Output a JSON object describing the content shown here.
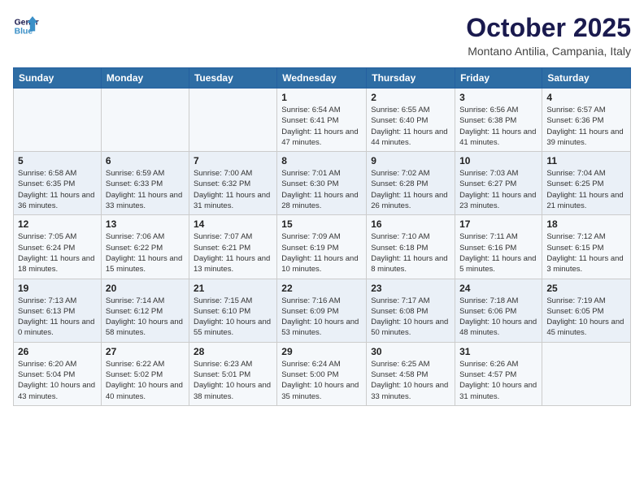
{
  "logo": {
    "line1": "General",
    "line2": "Blue"
  },
  "title": "October 2025",
  "subtitle": "Montano Antilia, Campania, Italy",
  "days_of_week": [
    "Sunday",
    "Monday",
    "Tuesday",
    "Wednesday",
    "Thursday",
    "Friday",
    "Saturday"
  ],
  "weeks": [
    [
      {
        "day": "",
        "info": ""
      },
      {
        "day": "",
        "info": ""
      },
      {
        "day": "",
        "info": ""
      },
      {
        "day": "1",
        "info": "Sunrise: 6:54 AM\nSunset: 6:41 PM\nDaylight: 11 hours and 47 minutes."
      },
      {
        "day": "2",
        "info": "Sunrise: 6:55 AM\nSunset: 6:40 PM\nDaylight: 11 hours and 44 minutes."
      },
      {
        "day": "3",
        "info": "Sunrise: 6:56 AM\nSunset: 6:38 PM\nDaylight: 11 hours and 41 minutes."
      },
      {
        "day": "4",
        "info": "Sunrise: 6:57 AM\nSunset: 6:36 PM\nDaylight: 11 hours and 39 minutes."
      }
    ],
    [
      {
        "day": "5",
        "info": "Sunrise: 6:58 AM\nSunset: 6:35 PM\nDaylight: 11 hours and 36 minutes."
      },
      {
        "day": "6",
        "info": "Sunrise: 6:59 AM\nSunset: 6:33 PM\nDaylight: 11 hours and 33 minutes."
      },
      {
        "day": "7",
        "info": "Sunrise: 7:00 AM\nSunset: 6:32 PM\nDaylight: 11 hours and 31 minutes."
      },
      {
        "day": "8",
        "info": "Sunrise: 7:01 AM\nSunset: 6:30 PM\nDaylight: 11 hours and 28 minutes."
      },
      {
        "day": "9",
        "info": "Sunrise: 7:02 AM\nSunset: 6:28 PM\nDaylight: 11 hours and 26 minutes."
      },
      {
        "day": "10",
        "info": "Sunrise: 7:03 AM\nSunset: 6:27 PM\nDaylight: 11 hours and 23 minutes."
      },
      {
        "day": "11",
        "info": "Sunrise: 7:04 AM\nSunset: 6:25 PM\nDaylight: 11 hours and 21 minutes."
      }
    ],
    [
      {
        "day": "12",
        "info": "Sunrise: 7:05 AM\nSunset: 6:24 PM\nDaylight: 11 hours and 18 minutes."
      },
      {
        "day": "13",
        "info": "Sunrise: 7:06 AM\nSunset: 6:22 PM\nDaylight: 11 hours and 15 minutes."
      },
      {
        "day": "14",
        "info": "Sunrise: 7:07 AM\nSunset: 6:21 PM\nDaylight: 11 hours and 13 minutes."
      },
      {
        "day": "15",
        "info": "Sunrise: 7:09 AM\nSunset: 6:19 PM\nDaylight: 11 hours and 10 minutes."
      },
      {
        "day": "16",
        "info": "Sunrise: 7:10 AM\nSunset: 6:18 PM\nDaylight: 11 hours and 8 minutes."
      },
      {
        "day": "17",
        "info": "Sunrise: 7:11 AM\nSunset: 6:16 PM\nDaylight: 11 hours and 5 minutes."
      },
      {
        "day": "18",
        "info": "Sunrise: 7:12 AM\nSunset: 6:15 PM\nDaylight: 11 hours and 3 minutes."
      }
    ],
    [
      {
        "day": "19",
        "info": "Sunrise: 7:13 AM\nSunset: 6:13 PM\nDaylight: 11 hours and 0 minutes."
      },
      {
        "day": "20",
        "info": "Sunrise: 7:14 AM\nSunset: 6:12 PM\nDaylight: 10 hours and 58 minutes."
      },
      {
        "day": "21",
        "info": "Sunrise: 7:15 AM\nSunset: 6:10 PM\nDaylight: 10 hours and 55 minutes."
      },
      {
        "day": "22",
        "info": "Sunrise: 7:16 AM\nSunset: 6:09 PM\nDaylight: 10 hours and 53 minutes."
      },
      {
        "day": "23",
        "info": "Sunrise: 7:17 AM\nSunset: 6:08 PM\nDaylight: 10 hours and 50 minutes."
      },
      {
        "day": "24",
        "info": "Sunrise: 7:18 AM\nSunset: 6:06 PM\nDaylight: 10 hours and 48 minutes."
      },
      {
        "day": "25",
        "info": "Sunrise: 7:19 AM\nSunset: 6:05 PM\nDaylight: 10 hours and 45 minutes."
      }
    ],
    [
      {
        "day": "26",
        "info": "Sunrise: 6:20 AM\nSunset: 5:04 PM\nDaylight: 10 hours and 43 minutes."
      },
      {
        "day": "27",
        "info": "Sunrise: 6:22 AM\nSunset: 5:02 PM\nDaylight: 10 hours and 40 minutes."
      },
      {
        "day": "28",
        "info": "Sunrise: 6:23 AM\nSunset: 5:01 PM\nDaylight: 10 hours and 38 minutes."
      },
      {
        "day": "29",
        "info": "Sunrise: 6:24 AM\nSunset: 5:00 PM\nDaylight: 10 hours and 35 minutes."
      },
      {
        "day": "30",
        "info": "Sunrise: 6:25 AM\nSunset: 4:58 PM\nDaylight: 10 hours and 33 minutes."
      },
      {
        "day": "31",
        "info": "Sunrise: 6:26 AM\nSunset: 4:57 PM\nDaylight: 10 hours and 31 minutes."
      },
      {
        "day": "",
        "info": ""
      }
    ]
  ]
}
